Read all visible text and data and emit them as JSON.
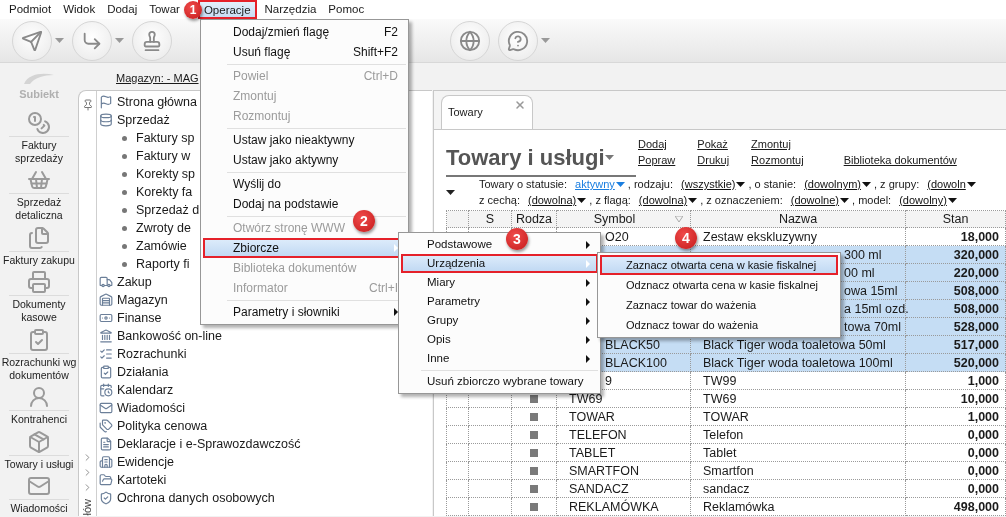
{
  "menu_bar": [
    {
      "label": "Podmiot",
      "selected": false
    },
    {
      "label": "Widok",
      "selected": false
    },
    {
      "label": "Dodaj",
      "selected": false
    },
    {
      "label": "Towar",
      "selected": false
    },
    {
      "label": "Operacje",
      "selected": true
    },
    {
      "label": "Narzędzia",
      "selected": false
    },
    {
      "label": "Pomoc",
      "selected": false
    }
  ],
  "logo": {
    "text": "Subiekt"
  },
  "nav": [
    {
      "label": "Faktury sprzedaży"
    },
    {
      "label": "Sprzedaż detaliczna"
    },
    {
      "label": "Faktury zakupu"
    },
    {
      "label": "Dokumenty kasowe"
    },
    {
      "label": "Rozrachunki wg dokumentów"
    },
    {
      "label": "Kontrahenci"
    },
    {
      "label": "Towary i usługi"
    },
    {
      "label": "Wiadomości"
    }
  ],
  "store_link": "Magazyn: - MAG",
  "side_strip_label": "łów",
  "tree": [
    {
      "label": "Strona główna"
    },
    {
      "label": "Sprzedaż",
      "children": [
        {
          "label": "Faktury sp"
        },
        {
          "label": "Faktury w"
        },
        {
          "label": "Korekty sp"
        },
        {
          "label": "Korekty fa"
        },
        {
          "label": "Sprzedaż d"
        },
        {
          "label": "Zwroty de"
        },
        {
          "label": "Zamówie"
        },
        {
          "label": "Raporty fi"
        }
      ]
    },
    {
      "label": "Zakup"
    },
    {
      "label": "Magazyn"
    },
    {
      "label": "Finanse"
    },
    {
      "label": "Bankowość on-line"
    },
    {
      "label": "Rozrachunki"
    },
    {
      "label": "Działania"
    },
    {
      "label": "Kalendarz"
    },
    {
      "label": "Wiadomości"
    },
    {
      "label": "Polityka cenowa"
    },
    {
      "label": "Deklaracje i e-Sprawozdawczość"
    },
    {
      "label": "Ewidencje"
    },
    {
      "label": "Kartoteki"
    },
    {
      "label": "Ochrona danych osobowych"
    }
  ],
  "tabs": [
    {
      "label": "Towary",
      "selected": true
    }
  ],
  "title": "Towary i usługi",
  "actions": [
    {
      "items": [
        "Dodaj",
        "Popraw"
      ]
    },
    {
      "items": [
        "Pokaż",
        "Drukuj"
      ]
    },
    {
      "items": [
        "Zmontuj",
        "Rozmontuj"
      ]
    },
    {
      "items": [
        "Biblioteka dokumentów"
      ]
    }
  ],
  "filters": [
    [
      {
        "label": "Towary o statusie:",
        "value": "aktywny",
        "highlighted": true
      },
      {
        "label": ", rodzaju:",
        "value": "(wszystkie)",
        "highlighted": false
      },
      {
        "label": ", o stanie:",
        "value": "(dowolnym)",
        "highlighted": false
      },
      {
        "label": ", z grupy:",
        "value": "(dowoln",
        "highlighted": false
      }
    ],
    [
      {
        "label": "z cechą:",
        "value": "(dowolna)",
        "highlighted": false
      },
      {
        "label": ", z flagą:",
        "value": "(dowolna)",
        "highlighted": false
      },
      {
        "label": ", z oznaczeniem:",
        "value": "(dowolne)",
        "highlighted": false
      },
      {
        "label": ", model:",
        "value": "(dowolny)",
        "highlighted": false
      }
    ]
  ],
  "table": {
    "columns": [
      "S",
      "Rodza",
      "Symbol",
      "Nazwa",
      "Stan"
    ],
    "rows": [
      {
        "symbol": "O20",
        "name": "Zestaw ekskluzywny",
        "stock": "18,000",
        "selected": false
      },
      {
        "name": "300 ml",
        "stock": "320,000",
        "selected": true
      },
      {
        "name": "00 ml",
        "stock": "220,000",
        "selected": true
      },
      {
        "name": "owa 15ml",
        "stock": "508,000",
        "selected": true
      },
      {
        "name": "a 15ml ozd.",
        "stock": "508,000",
        "selected": true
      },
      {
        "name": "towa 70ml",
        "stock": "528,000",
        "selected": true
      },
      {
        "symbol": "BLACK50",
        "name": "Black Tiger woda toaletowa 50ml",
        "stock": "517,000",
        "selected": true
      },
      {
        "symbol": "BLACK100",
        "name": "Black Tiger woda toaletowa 100ml",
        "stock": "520,000",
        "selected": true
      },
      {
        "symbol": "9",
        "name": "TW99",
        "stock": "1,000",
        "selected": false
      },
      {
        "symbol": "TW69",
        "name": "TW69",
        "stock": "10,000",
        "selected": false
      },
      {
        "symbol": "TOWAR",
        "name": "TOWAR",
        "stock": "1,000",
        "selected": false
      },
      {
        "symbol": "TELEFON",
        "name": "Telefon",
        "stock": "0,000",
        "selected": false
      },
      {
        "symbol": "TABLET",
        "name": "Tablet",
        "stock": "0,000",
        "selected": false
      },
      {
        "symbol": "SMARTFON",
        "name": "Smartfon",
        "stock": "0,000",
        "selected": false
      },
      {
        "symbol": "SANDACZ",
        "name": "sandacz",
        "stock": "0,000",
        "selected": false
      },
      {
        "symbol": "REKLAMÓWKA",
        "name": "Reklamówka",
        "stock": "498,000",
        "selected": false
      }
    ]
  },
  "menus": [
    {
      "items": [
        {
          "kind": "item",
          "label": "Dodaj/zmień flagę",
          "shortcut": "F2",
          "disabled": false,
          "selected": false,
          "submenu": false
        },
        {
          "kind": "item",
          "label": "Usuń flagę",
          "shortcut": "Shift+F2",
          "disabled": false,
          "selected": false,
          "submenu": false
        },
        {
          "kind": "separator"
        },
        {
          "kind": "item",
          "label": "Powiel",
          "shortcut": "Ctrl+D",
          "disabled": true,
          "selected": false,
          "submenu": false
        },
        {
          "kind": "item",
          "label": "Zmontuj",
          "disabled": true,
          "selected": false,
          "submenu": false
        },
        {
          "kind": "item",
          "label": "Rozmontuj",
          "disabled": true,
          "selected": false,
          "submenu": false
        },
        {
          "kind": "separator"
        },
        {
          "kind": "item",
          "label": "Ustaw jako nieaktywny",
          "disabled": false,
          "selected": false,
          "submenu": false
        },
        {
          "kind": "item",
          "label": "Ustaw jako aktywny",
          "disabled": false,
          "selected": false,
          "submenu": false
        },
        {
          "kind": "separator"
        },
        {
          "kind": "item",
          "label": "Wyślij do",
          "disabled": false,
          "selected": false,
          "submenu": false
        },
        {
          "kind": "item",
          "label": "Dodaj na podstawie",
          "disabled": false,
          "selected": false,
          "submenu": false
        },
        {
          "kind": "separator"
        },
        {
          "kind": "item",
          "label": "Otwórz stronę WWW",
          "disabled": true,
          "selected": false,
          "submenu": false
        },
        {
          "kind": "item",
          "label": "Zbiorcze",
          "disabled": false,
          "selected": true,
          "submenu": true
        },
        {
          "kind": "item",
          "label": "Biblioteka dokumentów",
          "disabled": true,
          "selected": false,
          "submenu": false
        },
        {
          "kind": "item",
          "label": "Informator",
          "shortcut": "Ctrl+I",
          "disabled": true,
          "selected": false,
          "submenu": false
        },
        {
          "kind": "separator"
        },
        {
          "kind": "item",
          "label": "Parametry i słowniki",
          "disabled": false,
          "selected": false,
          "submenu": true
        }
      ]
    },
    {
      "items": [
        {
          "kind": "item",
          "label": "Podstawowe",
          "disabled": false,
          "selected": false,
          "submenu": true
        },
        {
          "kind": "item",
          "label": "Urządzenia",
          "disabled": false,
          "selected": true,
          "submenu": true
        },
        {
          "kind": "item",
          "label": "Miary",
          "disabled": false,
          "selected": false,
          "submenu": true
        },
        {
          "kind": "item",
          "label": "Parametry",
          "disabled": false,
          "selected": false,
          "submenu": true
        },
        {
          "kind": "item",
          "label": "Grupy",
          "disabled": false,
          "selected": false,
          "submenu": true
        },
        {
          "kind": "item",
          "label": "Opis",
          "disabled": false,
          "selected": false,
          "submenu": true
        },
        {
          "kind": "item",
          "label": "Inne",
          "disabled": false,
          "selected": false,
          "submenu": true
        },
        {
          "kind": "separator"
        },
        {
          "kind": "item",
          "label": "Usuń zbiorczo wybrane towary",
          "disabled": false,
          "selected": false,
          "submenu": false
        }
      ]
    },
    {
      "items": [
        {
          "kind": "item",
          "label": "Zaznacz otwarta cena w kasie fiskalnej",
          "disabled": false,
          "selected": true,
          "submenu": false
        },
        {
          "kind": "item",
          "label": "Odznacz otwarta cena w kasie fiskalnej",
          "disabled": false,
          "selected": false,
          "submenu": false
        },
        {
          "kind": "item",
          "label": "Zaznacz towar do ważenia",
          "disabled": false,
          "selected": false,
          "submenu": false
        },
        {
          "kind": "item",
          "label": "Odznacz towar do ważenia",
          "disabled": false,
          "selected": false,
          "submenu": false
        }
      ]
    }
  ],
  "callouts": [
    "1",
    "2",
    "3",
    "4"
  ]
}
